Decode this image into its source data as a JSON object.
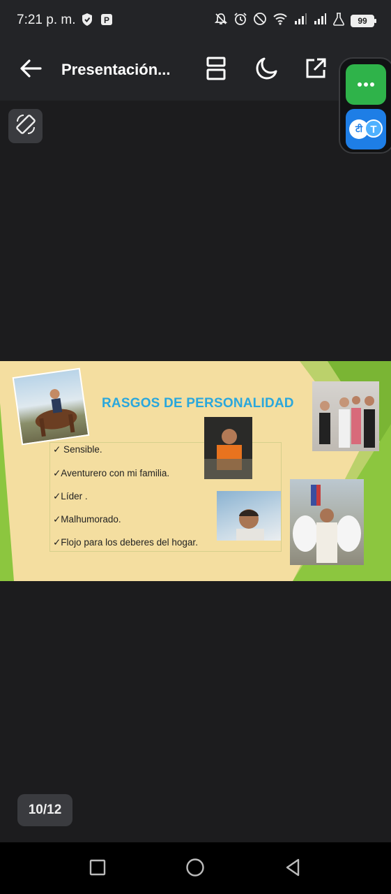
{
  "status_bar": {
    "time": "7:21 p. m.",
    "battery": "99",
    "left_icons": [
      "shield-icon",
      "app-notification-icon"
    ],
    "right_icons": [
      "bell-off-icon",
      "alarm-icon",
      "do-not-disturb-icon",
      "wifi-icon",
      "signal-icon",
      "signal-icon",
      "lab-flask-icon"
    ]
  },
  "app_bar": {
    "title": "Presentación...",
    "icons": [
      "back-arrow-icon",
      "page-layout-icon",
      "dark-mode-moon-icon",
      "open-external-icon"
    ]
  },
  "floating_panel": {
    "items": [
      {
        "icon": "more-dots-icon",
        "color": "#2fb34a"
      },
      {
        "icon": "translate-icon",
        "label_a": "टी",
        "label_b": "T",
        "color": "#1e7ee6"
      }
    ]
  },
  "rotate_button": {
    "icon": "screen-rotate-icon"
  },
  "slide": {
    "title": "RASGOS DE PERSONALIDAD",
    "items": [
      "✓ Sensible.",
      "✓Aventurero con mi familia.",
      "✓Líder .",
      "✓Malhumorado.",
      "✓Flojo para los  deberes del hogar."
    ],
    "colors": {
      "background": "#f4dea0",
      "title": "#2aa7dc",
      "accent_green": "#8cc63f"
    },
    "photos": [
      "boy-on-horse-photo",
      "boy-orange-shirt-photo",
      "family-group-photo",
      "boy-close-up-photo",
      "boy-angel-costume-photo"
    ]
  },
  "page_indicator": "10/12",
  "nav_bar": {
    "icons": [
      "recents-square-icon",
      "home-circle-icon",
      "back-triangle-icon"
    ]
  }
}
